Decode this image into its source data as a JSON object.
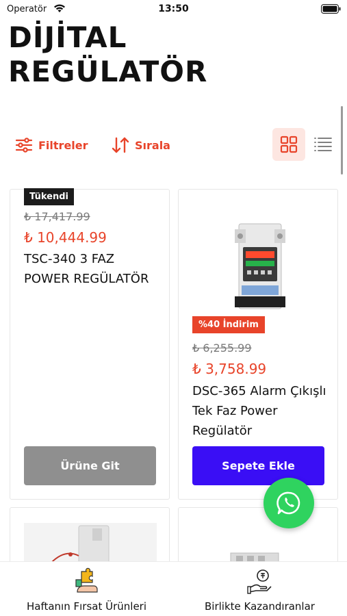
{
  "status_bar": {
    "carrier": "Operatör",
    "time": "13:50"
  },
  "page": {
    "title_line1": "DİJİTAL",
    "title_line2": "REGÜLATÖR"
  },
  "toolbar": {
    "filter_label": "Filtreler",
    "sort_label": "Sırala",
    "active_view": "grid"
  },
  "products": [
    {
      "badge": "Tükendi",
      "old_price": "₺ 17,417.99",
      "new_price": "₺ 10,444.99",
      "name": "TSC-340 3 FAZ POWER REGÜLATÖR",
      "button": "Ürüne Git",
      "button_color": "#8f8f8f"
    },
    {
      "badge": "%40 İndirim",
      "old_price": "₺ 6,255.99",
      "new_price": "₺ 3,758.99",
      "name": "DSC-365 Alarm Çıkışlı Tek Faz Power Regülatör",
      "button": "Sepete Ekle",
      "button_color": "#3a0ef5"
    }
  ],
  "bottom_nav": {
    "items": [
      {
        "label": "Haftanın Fırsat Ürünleri",
        "icon": "puzzle-hand-icon"
      },
      {
        "label": "Birlikte Kazandıranlar",
        "icon": "money-hand-icon"
      }
    ]
  },
  "colors": {
    "accent": "#e8442a",
    "primary_button": "#3a0ef5",
    "disabled_button": "#8f8f8f",
    "whatsapp": "#2fd35f"
  }
}
